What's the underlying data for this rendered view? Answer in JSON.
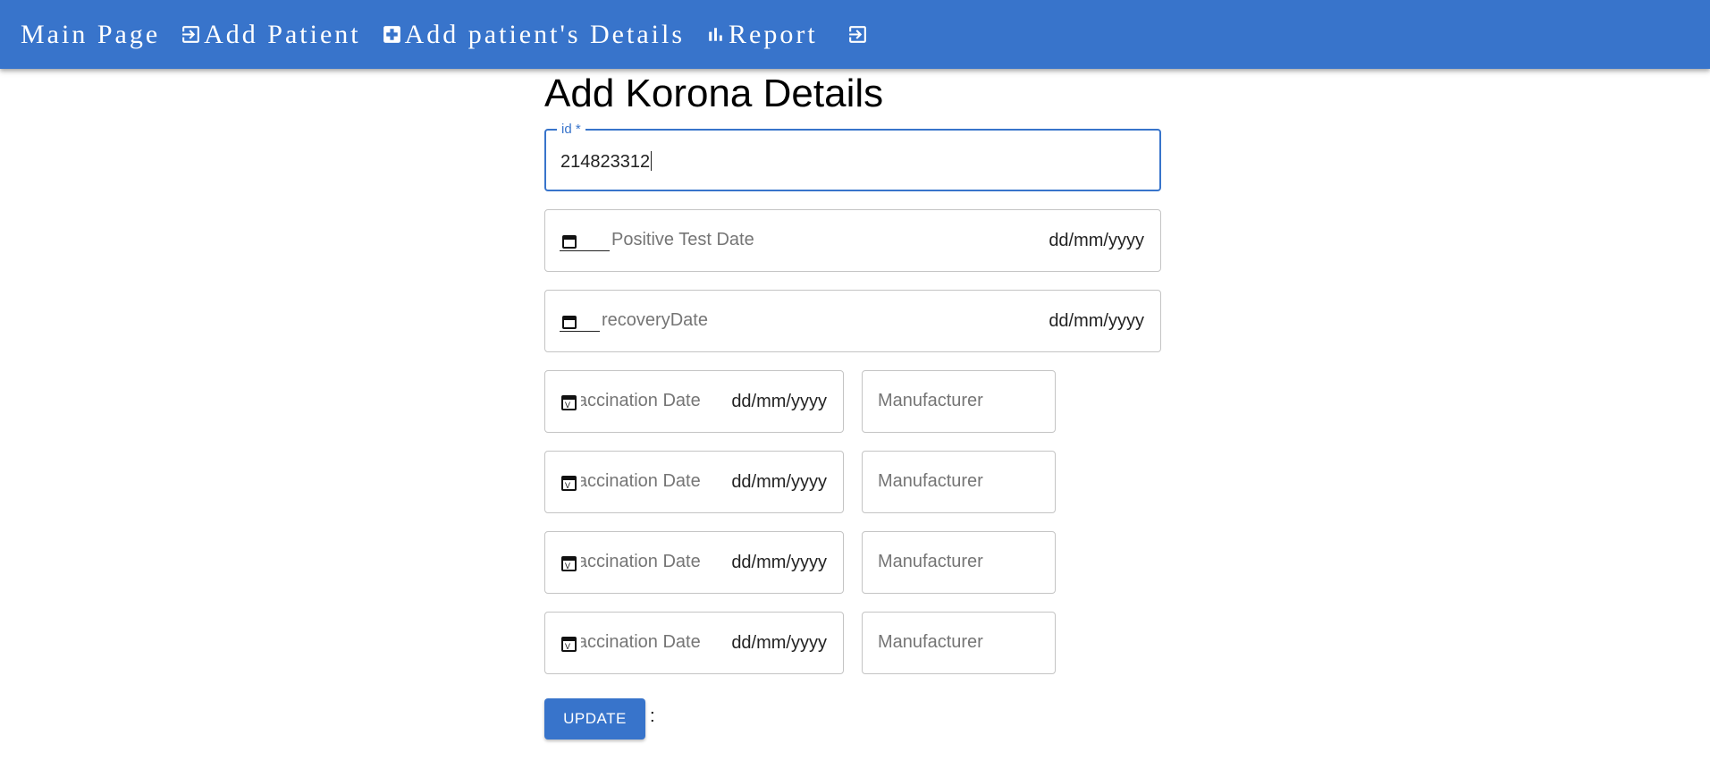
{
  "nav": {
    "main_page": "Main Page",
    "add_patient": "Add Patient",
    "add_details": "Add patient's Details",
    "report": "Report",
    "add_patient_icon": "login-arrow-icon",
    "add_details_icon": "medical-plus-icon",
    "report_icon": "bar-chart-icon",
    "logout_icon": "logout-icon"
  },
  "form": {
    "title": "Add Korona Details",
    "id_label": "id *",
    "id_value": "214823312",
    "positive_test_placeholder": "Positive Test Date",
    "recovery_placeholder": "recoveryDate",
    "date_format": "dd/mm/yyyy",
    "vaccinations": [
      {
        "date_placeholder": "Vaccination Date",
        "date_format": "dd/mm/yyyy",
        "manufacturer_placeholder": "Manufacturer"
      },
      {
        "date_placeholder": "Vaccination Date",
        "date_format": "dd/mm/yyyy",
        "manufacturer_placeholder": "Manufacturer"
      },
      {
        "date_placeholder": "Vaccination Date",
        "date_format": "dd/mm/yyyy",
        "manufacturer_placeholder": "Manufacturer"
      },
      {
        "date_placeholder": "Vaccination Date",
        "date_format": "dd/mm/yyyy",
        "manufacturer_placeholder": "Manufacturer"
      }
    ],
    "update_label": "UPDATE",
    "status_text": ":"
  },
  "colors": {
    "primary": "#3874cb",
    "border": "#c4c4c4",
    "placeholder": "#757575"
  }
}
